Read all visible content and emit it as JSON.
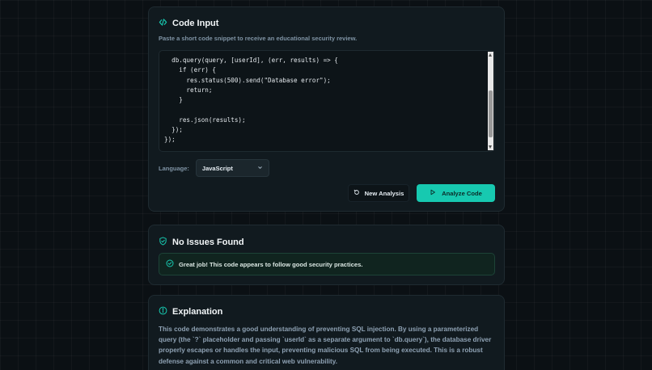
{
  "code_input": {
    "title": "Code Input",
    "subtitle": "Paste a short code snippet to receive an educational security review.",
    "code": "  db.query(query, [userId], (err, results) => {\n    if (err) {\n      res.status(500).send(\"Database error\");\n      return;\n    }\n\n    res.json(results);\n  });\n});",
    "language_label": "Language:",
    "language_value": "JavaScript",
    "new_analysis_label": "New Analysis",
    "analyze_label": "Analyze Code"
  },
  "result": {
    "title": "No Issues Found",
    "message": "Great job! This code appears to follow good security practices."
  },
  "explanation": {
    "title": "Explanation",
    "text": "This code demonstrates a good understanding of preventing SQL injection. By using a parameterized query (the `?` placeholder and passing `userId` as a separate argument to `db.query`), the database driver properly escapes or handles the input, preventing malicious SQL from being executed. This is a robust defense against a common and critical web vulnerability."
  },
  "icons": {
    "code": "code-icon",
    "shield": "shield-check-icon",
    "chevron": "chevron-down-icon",
    "refresh": "refresh-icon",
    "play": "play-icon",
    "check": "check-circle-icon",
    "info": "info-icon"
  },
  "colors": {
    "accent": "#17c9b0",
    "success_bg": "#10241f",
    "card_bg": "#111a1f",
    "page_bg": "#0b1014"
  }
}
